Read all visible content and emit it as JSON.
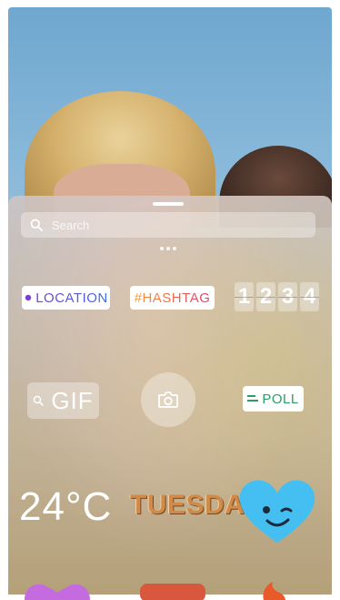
{
  "search": {
    "placeholder": "Search"
  },
  "stickers": {
    "location": {
      "label": "LOCATION"
    },
    "hashtag": {
      "label": "#HASHTAG"
    },
    "countdown": {
      "digits": [
        "1",
        "2",
        "3",
        "4"
      ]
    },
    "gif": {
      "label": "GIF"
    },
    "camera": {
      "icon": "camera-icon"
    },
    "poll": {
      "label": "POLL"
    },
    "temperature": {
      "label": "24°C"
    },
    "day": {
      "label": "TUESDAY"
    },
    "heart": {
      "icon": "winking-heart-icon"
    }
  },
  "colors": {
    "location": "#7a3fd6",
    "hashtag": "#f59a3a",
    "poll": "#2d9c65",
    "heart": "#45bff2",
    "tray": "#c8bdb5"
  }
}
